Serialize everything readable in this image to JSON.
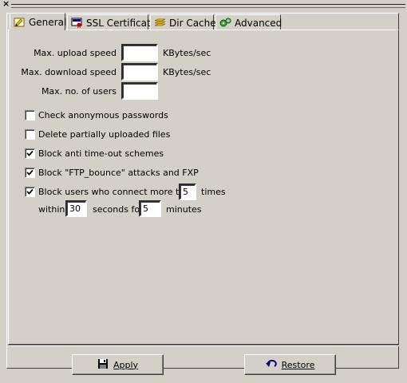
{
  "window": {
    "close_glyph": "×"
  },
  "tabs": [
    {
      "label": "General",
      "icon": "general-tab-icon",
      "active": true
    },
    {
      "label": "SSL Certificate",
      "icon": "certificate-icon",
      "active": false
    },
    {
      "label": "Dir Cache",
      "icon": "dir-cache-icon",
      "active": false
    },
    {
      "label": "Advanced",
      "icon": "advanced-icon",
      "active": false
    }
  ],
  "limits": {
    "upload_label": "Max. upload speed",
    "upload_value": "",
    "upload_unit": "KBytes/sec",
    "download_label": "Max. download speed",
    "download_value": "",
    "download_unit": "KBytes/sec",
    "users_label": "Max. no. of users",
    "users_value": ""
  },
  "options": [
    {
      "label": "Check anonymous passwords",
      "checked": false
    },
    {
      "label": "Delete partially uploaded files",
      "checked": false
    },
    {
      "label": "Block anti time-out schemes",
      "checked": true
    },
    {
      "label": "Block \"FTP_bounce\" attacks and FXP",
      "checked": true
    },
    {
      "label": "Block users who connect more than",
      "checked": true
    }
  ],
  "block_users": {
    "times_value": "5",
    "times_label": "times",
    "within_label": "within",
    "within_value": "30",
    "seconds_label": "seconds for",
    "minutes_value": "5",
    "minutes_label": "minutes"
  },
  "buttons": {
    "apply_label": "Apply",
    "restore_label": "Restore"
  },
  "colors": {
    "face": "#d4d0c8",
    "title_line": "#0a246a"
  }
}
